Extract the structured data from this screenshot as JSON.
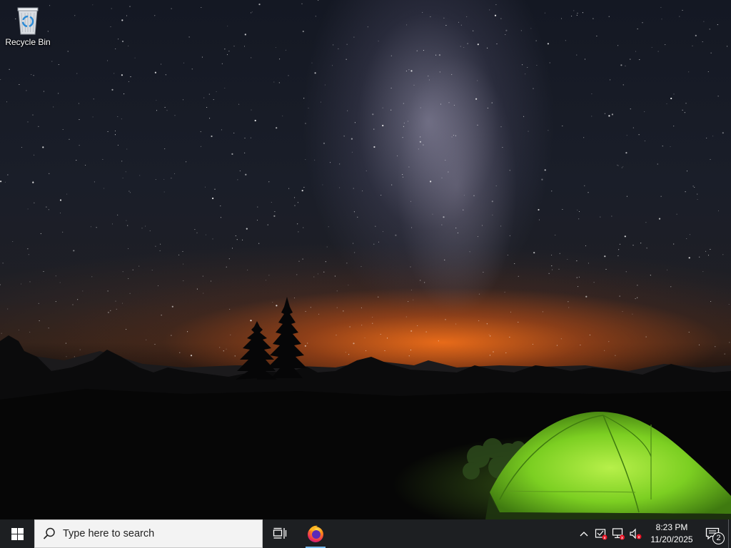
{
  "desktop": {
    "icons": [
      {
        "label": "Recycle Bin",
        "icon": "recycle-bin-icon"
      }
    ],
    "wallpaper": "night sky milky way with glowing green tent"
  },
  "taskbar": {
    "start_icon": "windows-logo-icon",
    "search": {
      "placeholder": "Type here to search",
      "icon": "search-icon"
    },
    "task_view_icon": "task-view-icon",
    "pinned": [
      {
        "name": "Firefox",
        "icon": "firefox-icon",
        "active": true
      }
    ],
    "tray": {
      "icons": [
        "chevron-up-icon",
        "security-alert-icon",
        "network-disconnected-icon",
        "volume-muted-icon"
      ],
      "time": "8:23 PM",
      "date": "11/20/2025",
      "notification_count": "2"
    }
  },
  "colors": {
    "taskbar_bg": "#1d1f22",
    "accent": "#76b9ed",
    "tent_green": "#7ed321"
  }
}
